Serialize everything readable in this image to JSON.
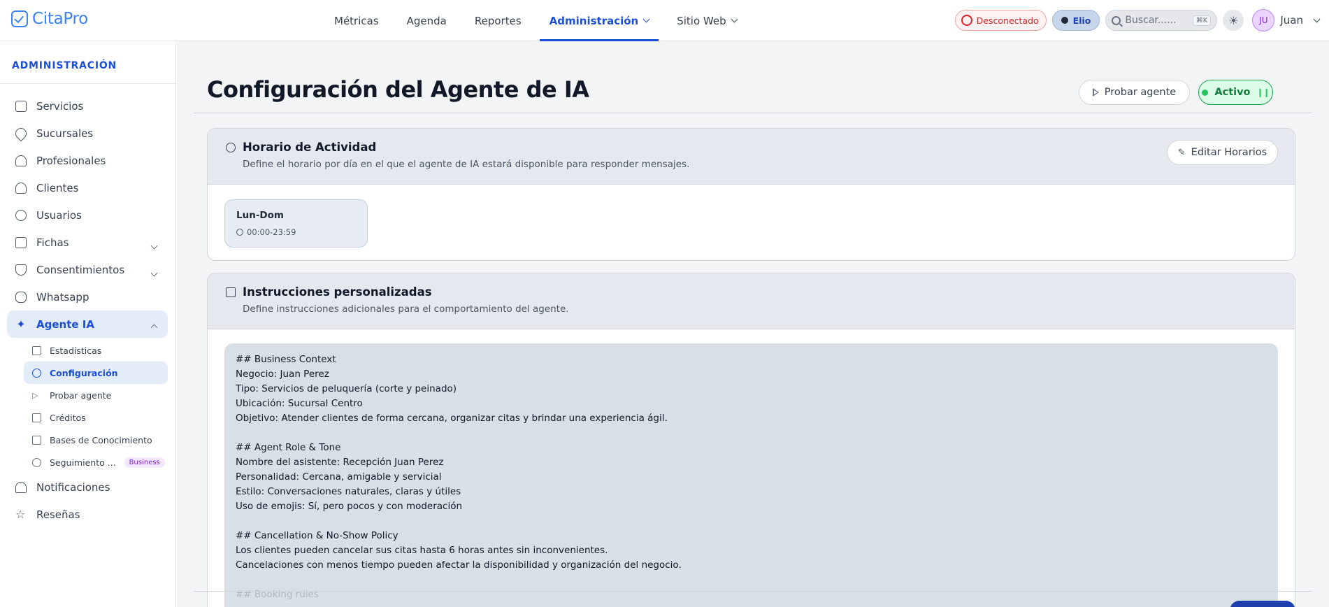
{
  "app": {
    "logo_text": "CitaPro",
    "brand_color": "#3b82f6",
    "accent_color": "#1d4ed8"
  },
  "nav": {
    "items": [
      {
        "label": "Métricas"
      },
      {
        "label": "Agenda"
      },
      {
        "label": "Reportes"
      },
      {
        "label": "Administración",
        "active": true,
        "dropdown": true
      },
      {
        "label": "Sitio Web",
        "dropdown": true
      }
    ]
  },
  "topbar": {
    "whatsapp_status": "Desconectado",
    "agent_name": "Elio",
    "search_placeholder": "Buscar......",
    "search_shortcut": "⌘K",
    "user_initials": "JU",
    "user_name": "Juan"
  },
  "sidebar": {
    "title": "ADMINISTRACIÓN",
    "items": [
      {
        "label": "Servicios",
        "icon": "box-icon"
      },
      {
        "label": "Sucursales",
        "icon": "map-pin-icon"
      },
      {
        "label": "Profesionales",
        "icon": "users-icon"
      },
      {
        "label": "Clientes",
        "icon": "contacts-icon"
      },
      {
        "label": "Usuarios",
        "icon": "user-circle-icon"
      },
      {
        "label": "Fichas",
        "icon": "files-icon",
        "expandable": true
      },
      {
        "label": "Consentimientos",
        "icon": "shield-check-icon",
        "expandable": true
      },
      {
        "label": "Whatsapp",
        "icon": "chat-icon"
      },
      {
        "label": "Agente IA",
        "icon": "sparkles-icon",
        "active": true,
        "expanded": true
      }
    ],
    "subitems": [
      {
        "label": "Estadísticas",
        "icon": "bar-chart-icon"
      },
      {
        "label": "Configuración",
        "icon": "settings-icon",
        "active": true
      },
      {
        "label": "Probar agente",
        "icon": "play-icon"
      },
      {
        "label": "Créditos",
        "icon": "credit-card-icon"
      },
      {
        "label": "Bases de Conocimiento",
        "icon": "book-icon"
      },
      {
        "label": "Seguimiento ...",
        "icon": "refresh-icon",
        "badge": "Business"
      }
    ],
    "bottom_items": [
      {
        "label": "Notificaciones",
        "icon": "bell-icon"
      },
      {
        "label": "Reseñas",
        "icon": "star-icon"
      }
    ]
  },
  "page": {
    "title": "Configuración del Agente de IA",
    "test_button": "Probar agente",
    "status_button": "Activo"
  },
  "schedule_card": {
    "title": "Horario de Actividad",
    "description": "Define el horario por día en el que el agente de IA estará disponible para responder mensajes.",
    "edit_button": "Editar Horarios",
    "slots": [
      {
        "days": "Lun-Dom",
        "time": "00:00-23:59"
      }
    ]
  },
  "instructions_card": {
    "title": "Instrucciones personalizadas",
    "description": "Define instrucciones adicionales para el comportamiento del agente.",
    "lines": [
      "## Business Context",
      "Negocio: Juan Perez",
      "Tipo: Servicios de peluquería (corte y peinado)",
      "Ubicación: Sucursal Centro",
      "Objetivo: Atender clientes de forma cercana, organizar citas y brindar una experiencia ágil.",
      "",
      "## Agent Role & Tone",
      "Nombre del asistente: Recepción Juan Perez",
      "Personalidad: Cercana, amigable y servicial",
      "Estilo: Conversaciones naturales, claras y útiles",
      "Uso de emojis: Sí, pero pocos y con moderación",
      "",
      "## Cancellation & No-Show Policy",
      "Los clientes pueden cancelar sus citas hasta 6 horas antes sin inconvenientes.",
      "Cancelaciones con menos tiempo pueden afectar la disponibilidad y organización del negocio.",
      "",
      "## Booking rules"
    ]
  }
}
